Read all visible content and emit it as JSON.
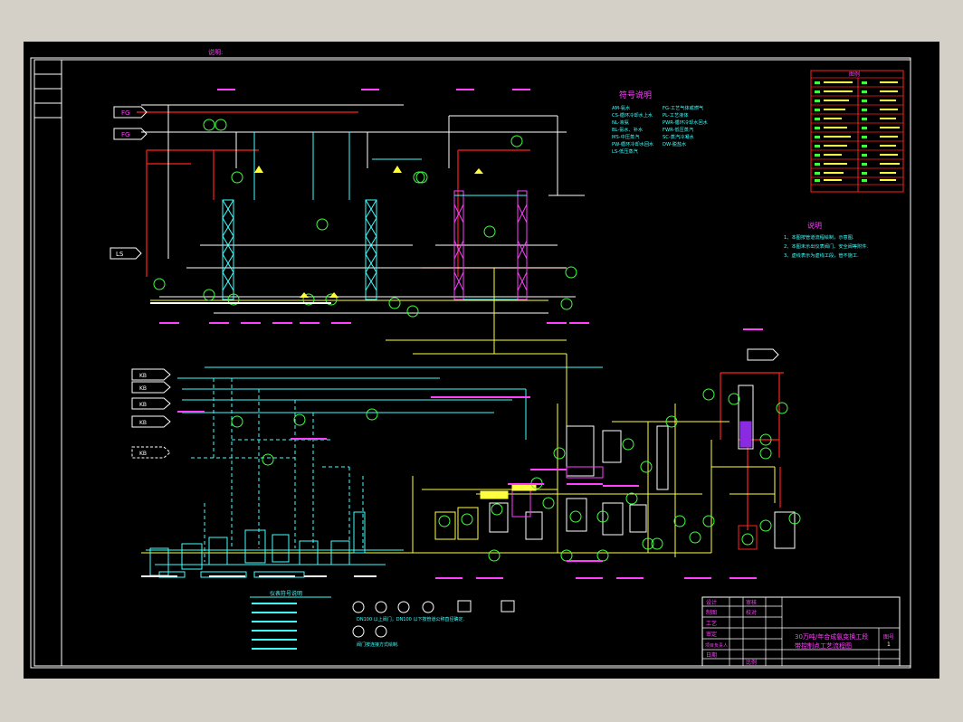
{
  "drawing": {
    "top_note": "说明:",
    "sources": {
      "s1": "FG",
      "s2": "FG",
      "ls": "LS",
      "c1": "KB",
      "c2": "KB",
      "c3": "KB",
      "c4": "KB",
      "c5": "KB"
    },
    "legend_title": "符号说明",
    "legend_left": [
      "AM-氨水",
      "CS-循环冷却水上水",
      "NL-液氨",
      "BL-氨水、补水",
      "MS-中压蒸汽",
      "PW-循环冷却水回水",
      "LS-低压蒸汽"
    ],
    "legend_right": [
      "FG-工艺气体或燃气",
      "PL-工艺液体",
      "PWR-循环冷却水回水",
      "FWR-低压蒸汽",
      "SC-蒸汽冷凝水",
      "DW-脱盐水"
    ],
    "symbol_table_title": "图例",
    "notes_title": "说明",
    "notes": [
      "1、本图按管道流程绘制，示意图.",
      "2、本图未示出仪表阀门、安全阀等附件.",
      "3、虚线表示为虚线工段，管不施工."
    ],
    "bottom_legend_title": "仪表符号说明",
    "bottom_desc_1": "DN100 以上阀门，DN100 以下按管道公称直径确定.",
    "bottom_desc_2": "阀门按连接方式绘制.",
    "title_block": {
      "r1": [
        "设计",
        "审核"
      ],
      "r2": [
        "制图",
        "校对"
      ],
      "r3": [
        "工艺",
        ""
      ],
      "r4": [
        "审定",
        ""
      ],
      "r5": [
        "项目负责人",
        ""
      ],
      "r6": [
        "日期",
        "比例"
      ],
      "title_line1": "30万吨/年合成氨变换工段",
      "title_line2": "带控制点工艺流程图",
      "drawing_no_label": "图号",
      "drawing_no": "1"
    }
  },
  "colors": {
    "background": "#000000",
    "frame": "#ffffff",
    "steam": "#ff2020",
    "process": "#ffff40",
    "water": "#40ffff",
    "instrument": "#40ff40",
    "label": "#ff40ff",
    "gas": "#ffffff"
  }
}
